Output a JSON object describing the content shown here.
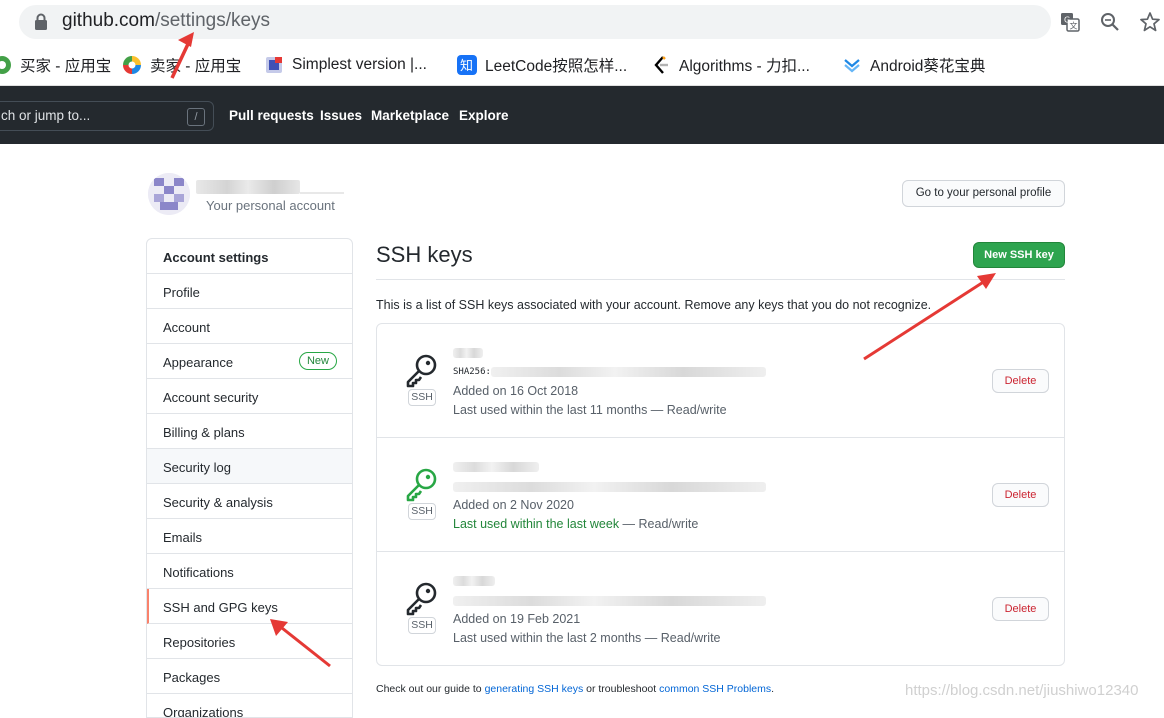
{
  "browser": {
    "url_host": "github.com",
    "url_path": "/settings/keys",
    "bookmarks": [
      {
        "label": "买家 - 应用宝",
        "icon": "yingyongbao-icon"
      },
      {
        "label": "卖家 - 应用宝",
        "icon": "yingyongbao-icon"
      },
      {
        "label": "Simplest version |...",
        "icon": "doc-favicon-icon"
      },
      {
        "label": "LeetCode按照怎样...",
        "icon": "zhihu-icon"
      },
      {
        "label": "Algorithms - 力扣...",
        "icon": "leetcode-icon"
      },
      {
        "label": "Android葵花宝典",
        "icon": "bookmark-chevron-icon"
      }
    ]
  },
  "gh_header": {
    "search_placeholder": "ch or jump to...",
    "search_shortcut": "/",
    "nav": [
      "Pull requests",
      "Issues",
      "Marketplace",
      "Explore"
    ]
  },
  "account": {
    "subtitle": "Your personal account",
    "profile_button": "Go to your personal profile"
  },
  "sidebar": {
    "header": "Account settings",
    "items": [
      "Profile",
      "Account",
      "Appearance",
      "Account security",
      "Billing & plans",
      "Security log",
      "Security & analysis",
      "Emails",
      "Notifications",
      "SSH and GPG keys",
      "Repositories",
      "Packages",
      "Organizations"
    ],
    "new_badge": "New"
  },
  "main": {
    "title": "SSH keys",
    "new_button": "New SSH key",
    "intro": "This is a list of SSH keys associated with your account. Remove any keys that you do not recognize.",
    "ssh_badge": "SSH",
    "delete_label": "Delete",
    "keys": [
      {
        "sha_prefix": "SHA256:",
        "added": "Added on 16 Oct 2018",
        "used": "Last used within the last 11 months",
        "access": " — Read/write",
        "recent": false
      },
      {
        "sha_prefix": "",
        "added": "Added on 2 Nov 2020",
        "used": "Last used within the last week",
        "access": " — Read/write",
        "recent": true
      },
      {
        "sha_prefix": "",
        "added": "Added on 19 Feb 2021",
        "used": "Last used within the last 2 months",
        "access": " — Read/write",
        "recent": false
      }
    ]
  },
  "footer": {
    "pre": "Check out our guide to ",
    "link1": "generating SSH keys",
    "mid": " or troubleshoot ",
    "link2": "common SSH Problems",
    "post": "."
  },
  "watermark": "https://blog.csdn.net/jiushiwo12340",
  "colors": {
    "header_bg": "#24292e",
    "primary_green": "#2ea44f",
    "danger_red": "#cb2431",
    "link_blue": "#0366d6",
    "annotation_red": "#e53935",
    "selected_accent": "#f9826c"
  }
}
